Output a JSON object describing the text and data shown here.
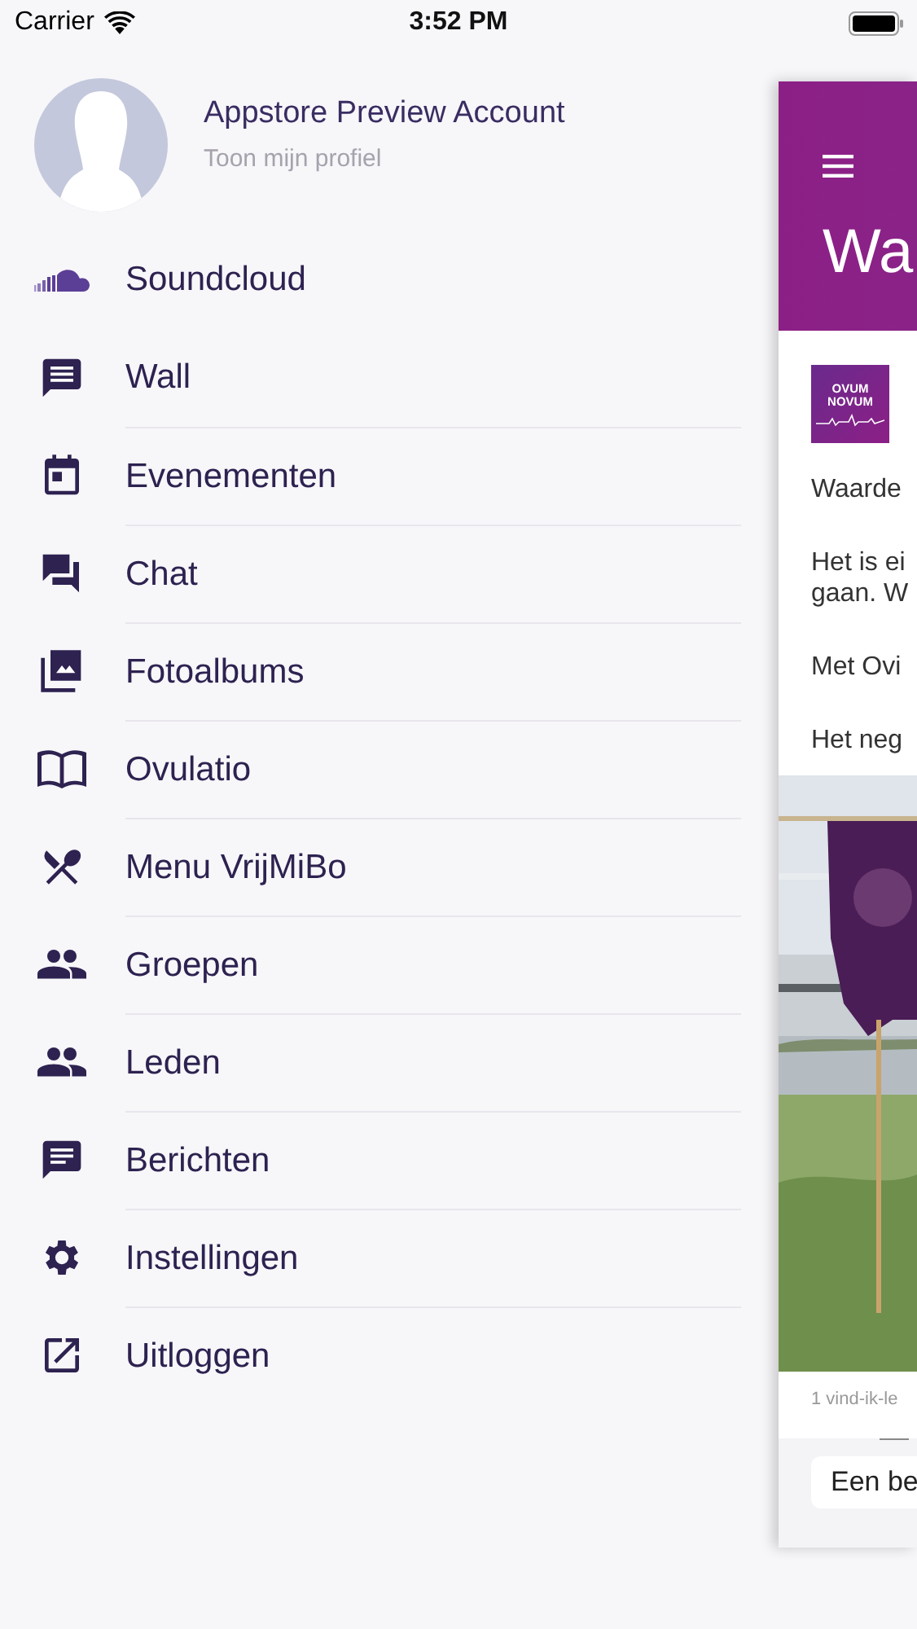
{
  "status_bar": {
    "carrier": "Carrier",
    "time": "3:52 PM"
  },
  "profile": {
    "name": "Appstore Preview Account",
    "link": "Toon mijn profiel"
  },
  "menu": [
    {
      "label": "Soundcloud"
    },
    {
      "label": "Wall"
    },
    {
      "label": "Evenementen"
    },
    {
      "label": "Chat"
    },
    {
      "label": "Fotoalbums"
    },
    {
      "label": "Ovulatio"
    },
    {
      "label": "Menu VrijMiBo"
    },
    {
      "label": "Groepen"
    },
    {
      "label": "Leden"
    },
    {
      "label": "Berichten"
    },
    {
      "label": "Instellingen"
    },
    {
      "label": "Uitloggen"
    }
  ],
  "behind_screen": {
    "title": "Wa",
    "logo_text": [
      "OVUM",
      "NOVUM"
    ],
    "post_lines": [
      "Waarde",
      "Het is ei",
      "gaan. W",
      "Met Ovi",
      "Het neg"
    ],
    "likes": "1 vind-ik-le",
    "comment_button": "Een be"
  }
}
